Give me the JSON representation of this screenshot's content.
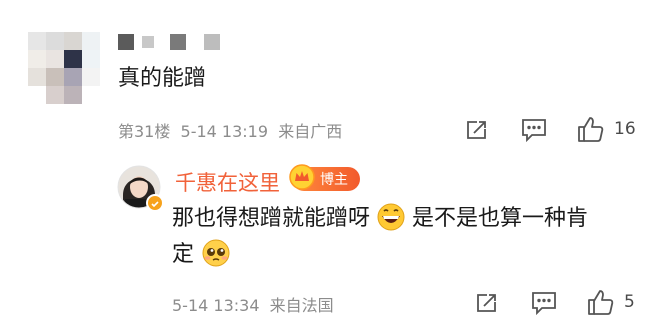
{
  "comment1": {
    "body": "真的能蹭",
    "meta": "第31楼  5-14 13:19  来自广西",
    "like_count": "16",
    "icons": [
      "share-icon",
      "comment-icon",
      "thumbs-up-icon"
    ]
  },
  "reply": {
    "author": "千惠在这里",
    "badge": "博主",
    "body_part1": "那也得想蹭就能蹭呀",
    "body_part2": "是不是也算一种肯",
    "body_part3": "定",
    "emoji1": "grinning-face-emoji",
    "emoji2": "pleading-face-emoji",
    "meta": "5-14 13:34  来自法国",
    "like_count": "5",
    "icons": [
      "share-icon",
      "comment-icon",
      "thumbs-up-icon"
    ]
  },
  "colors": {
    "author_name": "#f1623a",
    "meta_text": "#8c8c8c",
    "badge_bg": "#f25a2c",
    "icon_stroke": "#555555"
  }
}
